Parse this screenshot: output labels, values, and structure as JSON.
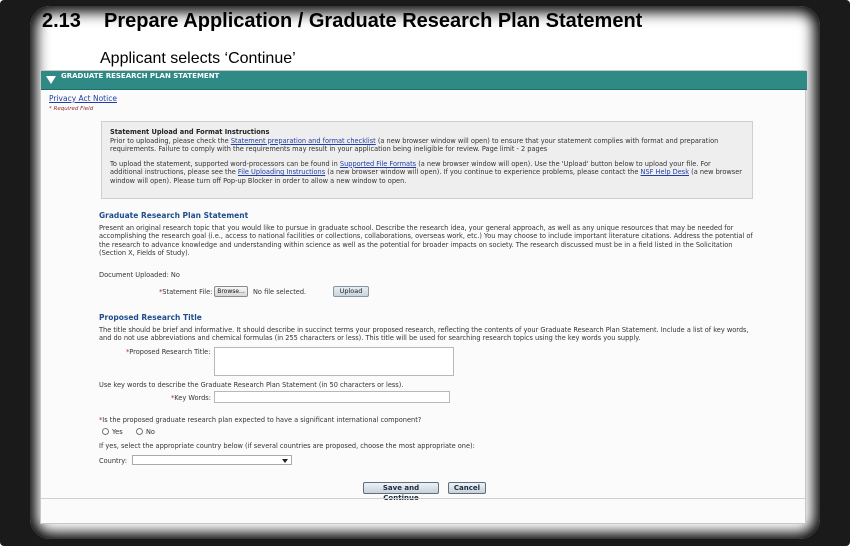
{
  "doc": {
    "section_number": "2.13",
    "section_title": "Prepare Application / Graduate Research Plan Statement",
    "subtitle": "Applicant selects ‘Continue’"
  },
  "header_bar": {
    "title": "GRADUATE RESEARCH PLAN STATEMENT"
  },
  "links": {
    "privacy": "Privacy Act Notice"
  },
  "required_note": "* Required Field",
  "instructions": {
    "heading": "Statement Upload and Format Instructions",
    "p1_a": "Prior to uploading, please check the ",
    "p1_link": "Statement preparation and format checklist",
    "p1_b": " (a new browser window will open) to ensure that your statement complies with format and preparation requirements. Failure to comply with the requirements may result in your application being ineligible for review. Page limit - 2 pages",
    "p2_a": "To upload the statement, supported word-processors can be found in ",
    "p2_link1": "Supported File Formats",
    "p2_b": " (a new browser window will open). Use the 'Upload' button below to upload your file. For additional instructions, please see the ",
    "p2_link2": "File Uploading Instructions",
    "p2_c": " (a new browser window will open). If you continue to experience problems, please contact the ",
    "p2_link3": "NSF Help Desk",
    "p2_d": " (a new browser window will open). Please turn off Pop-up Blocker in order to allow a new window to open."
  },
  "plan_section": {
    "title": "Graduate Research Plan Statement",
    "description": "Present an original research topic that you would like to pursue in graduate school. Describe the research idea, your general approach, as well as any unique resources that may be needed for accomplishing the research goal (i.e., access to national facilities or collections, collaborations, overseas work, etc.) You may choose to include important literature citations. Address the potential of the research to advance knowledge and understanding within science as well as the potential for broader impacts on society. The research discussed must be in a field listed in the Solicitation (Section X, Fields of Study).",
    "doc_uploaded_label": "Document Uploaded: No",
    "statement_file_label": "Statement File:",
    "browse_label": "Browse...",
    "no_file_text": "No file selected.",
    "upload_label": "Upload"
  },
  "title_section": {
    "title": "Proposed Research Title",
    "description": "The title should be brief and informative. It should describe in succinct terms your proposed research, reflecting the contents of your Graduate Research Plan Statement. Include a list of key words, and do not use abbreviations and chemical formulas (in 255 characters or less). This title will be used for searching research topics using the key words you supply.",
    "title_label": "Proposed Research Title:",
    "title_value": "",
    "keywords_hint": "Use key words to describe the Graduate Research Plan Statement (in 50 characters or less).",
    "keywords_label": "Key Words:",
    "keywords_value": ""
  },
  "international": {
    "question": "Is the proposed graduate research plan expected to have a significant international component?",
    "yes_label": "Yes",
    "no_label": "No",
    "country_hint": "If yes, select the appropriate country below (if several countries are proposed, choose the most appropriate one):",
    "country_label": "Country:",
    "country_value": ""
  },
  "actions": {
    "save_continue": "Save and Continue",
    "cancel": "Cancel"
  },
  "required_marker": "*",
  "colors": {
    "header_bar": "#2f8a86",
    "section_title": "#1f4e8c",
    "link": "#1f3ea8",
    "required": "#b01e1e"
  }
}
